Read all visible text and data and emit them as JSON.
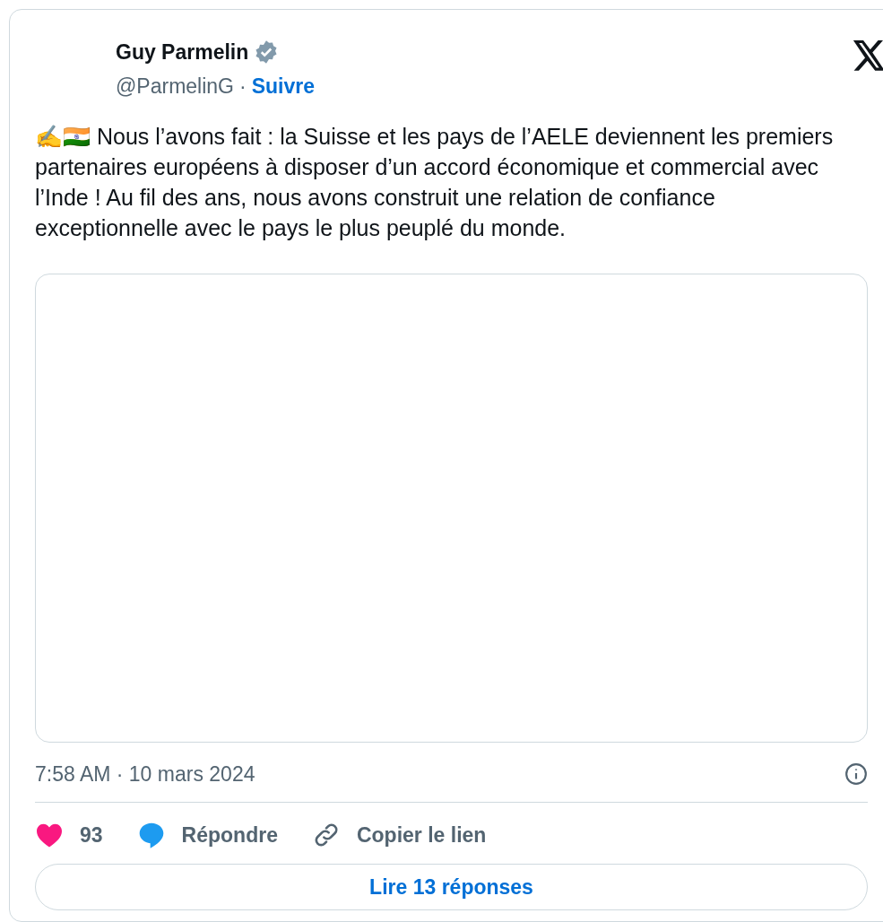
{
  "author": {
    "name": "Guy Parmelin",
    "verified": true,
    "handle": "@ParmelinG",
    "separator": "·",
    "follow": "Suivre"
  },
  "text": "✍️🇮🇳 Nous l’avons fait : la Suisse et les pays de l’AELE deviennent les premiers partenaires européens à disposer d’un accord économique et commercial avec l’Inde ! Au fil des ans, nous avons construit une relation de confiance exceptionnelle avec le pays le plus peuplé du monde.",
  "timestamp": "7:58 AM · 10 mars 2024",
  "actions": [
    {
      "kind": "like",
      "label": "93"
    },
    {
      "kind": "reply",
      "label": "Répondre"
    },
    {
      "kind": "copy",
      "label": "Copier le lien"
    }
  ],
  "read_replies": "Lire 13 réponses"
}
